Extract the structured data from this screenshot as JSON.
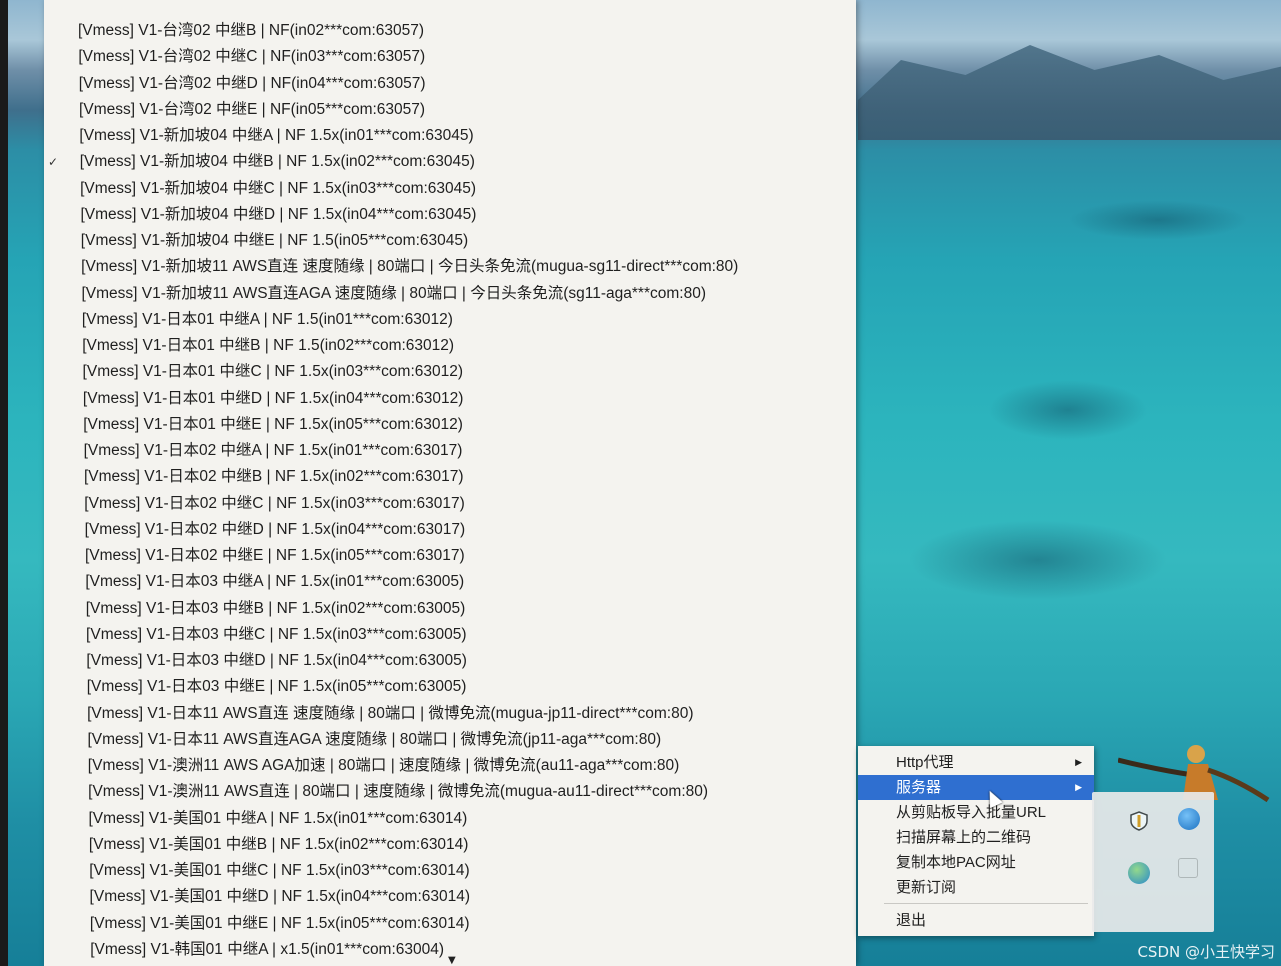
{
  "server_menu": {
    "items": [
      {
        "label": "[Vmess] V1-台湾02 中继B | NF(in02***com:63057)",
        "checked": false
      },
      {
        "label": "[Vmess] V1-台湾02 中继C | NF(in03***com:63057)",
        "checked": false
      },
      {
        "label": "[Vmess] V1-台湾02 中继D | NF(in04***com:63057)",
        "checked": false
      },
      {
        "label": "[Vmess] V1-台湾02 中继E | NF(in05***com:63057)",
        "checked": false
      },
      {
        "label": "[Vmess] V1-新加坡04 中继A | NF 1.5x(in01***com:63045)",
        "checked": false
      },
      {
        "label": "[Vmess] V1-新加坡04 中继B | NF 1.5x(in02***com:63045)",
        "checked": true
      },
      {
        "label": "[Vmess] V1-新加坡04 中继C | NF 1.5x(in03***com:63045)",
        "checked": false
      },
      {
        "label": "[Vmess] V1-新加坡04 中继D | NF 1.5x(in04***com:63045)",
        "checked": false
      },
      {
        "label": "[Vmess] V1-新加坡04 中继E | NF 1.5(in05***com:63045)",
        "checked": false
      },
      {
        "label": "[Vmess] V1-新加坡11 AWS直连 速度随缘 | 80端口 | 今日头条免流(mugua-sg11-direct***com:80)",
        "checked": false
      },
      {
        "label": "[Vmess] V1-新加坡11 AWS直连AGA 速度随缘 | 80端口 | 今日头条免流(sg11-aga***com:80)",
        "checked": false
      },
      {
        "label": "[Vmess] V1-日本01 中继A | NF 1.5(in01***com:63012)",
        "checked": false
      },
      {
        "label": "[Vmess] V1-日本01 中继B | NF 1.5(in02***com:63012)",
        "checked": false
      },
      {
        "label": "[Vmess] V1-日本01 中继C | NF 1.5x(in03***com:63012)",
        "checked": false
      },
      {
        "label": "[Vmess] V1-日本01 中继D | NF 1.5x(in04***com:63012)",
        "checked": false
      },
      {
        "label": "[Vmess] V1-日本01 中继E | NF 1.5x(in05***com:63012)",
        "checked": false
      },
      {
        "label": "[Vmess] V1-日本02 中继A | NF 1.5x(in01***com:63017)",
        "checked": false
      },
      {
        "label": "[Vmess] V1-日本02 中继B | NF 1.5x(in02***com:63017)",
        "checked": false
      },
      {
        "label": "[Vmess] V1-日本02 中继C | NF 1.5x(in03***com:63017)",
        "checked": false
      },
      {
        "label": "[Vmess] V1-日本02 中继D | NF 1.5x(in04***com:63017)",
        "checked": false
      },
      {
        "label": "[Vmess] V1-日本02 中继E | NF 1.5x(in05***com:63017)",
        "checked": false
      },
      {
        "label": "[Vmess] V1-日本03 中继A | NF 1.5x(in01***com:63005)",
        "checked": false
      },
      {
        "label": "[Vmess] V1-日本03 中继B | NF 1.5x(in02***com:63005)",
        "checked": false
      },
      {
        "label": "[Vmess] V1-日本03 中继C | NF 1.5x(in03***com:63005)",
        "checked": false
      },
      {
        "label": "[Vmess] V1-日本03 中继D | NF 1.5x(in04***com:63005)",
        "checked": false
      },
      {
        "label": "[Vmess] V1-日本03 中继E | NF 1.5x(in05***com:63005)",
        "checked": false
      },
      {
        "label": "[Vmess] V1-日本11 AWS直连 速度随缘 | 80端口 | 微博免流(mugua-jp11-direct***com:80)",
        "checked": false
      },
      {
        "label": "[Vmess] V1-日本11 AWS直连AGA 速度随缘 | 80端口 | 微博免流(jp11-aga***com:80)",
        "checked": false
      },
      {
        "label": "[Vmess] V1-澳洲11 AWS AGA加速 | 80端口 | 速度随缘 | 微博免流(au11-aga***com:80)",
        "checked": false
      },
      {
        "label": "[Vmess] V1-澳洲11 AWS直连 | 80端口 | 速度随缘 | 微博免流(mugua-au11-direct***com:80)",
        "checked": false
      },
      {
        "label": "[Vmess] V1-美国01 中继A | NF 1.5x(in01***com:63014)",
        "checked": false
      },
      {
        "label": "[Vmess] V1-美国01 中继B | NF 1.5x(in02***com:63014)",
        "checked": false
      },
      {
        "label": "[Vmess] V1-美国01 中继C | NF 1.5x(in03***com:63014)",
        "checked": false
      },
      {
        "label": "[Vmess] V1-美国01 中继D | NF 1.5x(in04***com:63014)",
        "checked": false
      },
      {
        "label": "[Vmess] V1-美国01 中继E | NF 1.5x(in05***com:63014)",
        "checked": false
      },
      {
        "label": "[Vmess] V1-韩国01 中继A | x1.5(in01***com:63004)",
        "checked": false
      }
    ],
    "check_mark": "✓",
    "scroll_down_icon": "triangle-down-icon"
  },
  "context_menu": {
    "items": [
      {
        "label": "Http代理",
        "submenu": true,
        "selected": false
      },
      {
        "label": "服务器",
        "submenu": true,
        "selected": true
      },
      {
        "label": "从剪贴板导入批量URL",
        "submenu": false,
        "selected": false
      },
      {
        "label": "扫描屏幕上的二维码",
        "submenu": false,
        "selected": false
      },
      {
        "label": "复制本地PAC网址",
        "submenu": false,
        "selected": false
      },
      {
        "label": "更新订阅",
        "submenu": false,
        "selected": false
      },
      {
        "label": "退出",
        "submenu": false,
        "selected": false
      }
    ],
    "selected_color": "#2f6fd0"
  },
  "tray": {
    "icons": [
      "shield-icon",
      "globe-icon",
      "globe-icon",
      "window-icon"
    ]
  },
  "watermark": "CSDN @小王快学习"
}
